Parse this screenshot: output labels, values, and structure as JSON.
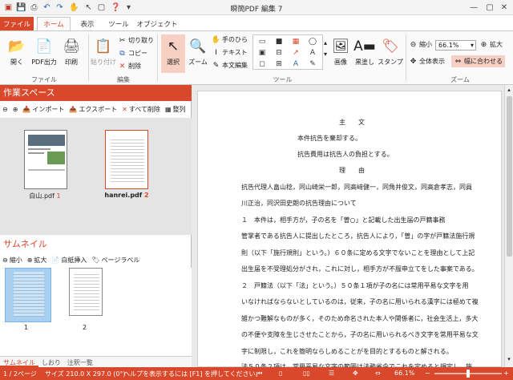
{
  "app": {
    "title": "瞬簡PDF 編集 7"
  },
  "tabs": [
    {
      "label": "ファイル"
    },
    {
      "label": "ホーム"
    },
    {
      "label": "表示"
    },
    {
      "label": "ツール"
    },
    {
      "label": "オブジェクト"
    }
  ],
  "ribbon": {
    "file_group": {
      "open": "開く",
      "pdf_out": "PDF出力",
      "print": "印刷",
      "label": "ファイル"
    },
    "edit_group": {
      "paste": "貼り付け",
      "cut": "切り取り",
      "copy": "コピー",
      "delete": "削除",
      "label": "編集"
    },
    "tool_group": {
      "select": "選択",
      "zoom": "ズーム",
      "hand": "手のひら",
      "text": "テキスト",
      "body_edit": "本文編集",
      "image": "画像",
      "black_fill": "黒塗し",
      "stamp": "スタンプ",
      "label": "ツール"
    },
    "zoom_group": {
      "shrink": "縮小",
      "zoom_value": "66.1%",
      "enlarge": "拡大",
      "full_view": "全体表示",
      "fit_width": "幅に合わせる",
      "label": "ズーム"
    }
  },
  "workspace": {
    "title": "作業スペース",
    "import": "インポート",
    "export": "エクスポート",
    "delete_all": "すべて削除",
    "arrange": "整列",
    "files": [
      {
        "name": "白山.pdf",
        "count": "1"
      },
      {
        "name": "hanrei.pdf",
        "count": "2"
      }
    ]
  },
  "thumbnail": {
    "title": "サムネイル",
    "shrink": "縮小",
    "enlarge": "拡大",
    "insert_blank": "白紙挿入",
    "page_label": "ページラベル",
    "pages": [
      {
        "label": "1"
      },
      {
        "label": "2"
      }
    ]
  },
  "bottom_tabs": [
    {
      "label": "サムネイル"
    },
    {
      "label": "しおり"
    },
    {
      "label": "注釈一覧"
    }
  ],
  "document": {
    "lines": [
      "主　　文",
      "本件抗告を棄却する。",
      "抗告費用は抗告人の負担とする。",
      "理　　由",
      "抗告代理人畠山稔，同山崎栄一郎，同高﨑健一，同角井俊文，同高倉孝志，同員",
      "川正治，同沢田史朗の抗告理由について",
      "１　本件は，相手方が，子の名を「曽○」と記載した出生届の戸籍事務",
      "管掌者である抗告人に提出したところ，抗告人により，「曽」の字が戸籍法施行規",
      "則（以下「施行規則」という。）６０条に定める文字でないことを理由として上記",
      "出生届を不受理処分がされ，これに対し，相手方が不服申立てをした事案である。",
      "２　戸籍法（以下「法」という。）５０条１項が子の名には常用平易な文字を用",
      "いなければならないとしているのは，従来，子の名に用いられる漢字には極めて複",
      "雑かつ難解なものが多く，そのため命名された本人や関係者に，社会生活上，多大",
      "の不便や支障を生じさせたことから，子の名に用いられるべき文字を常用平易な文",
      "字に制限し，これを簡明ならしめることがを目的とするものと解される。",
      "法５０条２項は，常用平易な文字の範囲は法務省令でこれを定めると規定し，施"
    ]
  },
  "status": {
    "pages": "1 / 2ページ",
    "size": "サイズ 210.0 X 297.0 (0°)",
    "help": "ヘルプを表示するには [F1] を押してください。",
    "zoom": "66.1%"
  },
  "colors": {
    "accent": "#d9482b",
    "status_bar": "#d9482b"
  }
}
